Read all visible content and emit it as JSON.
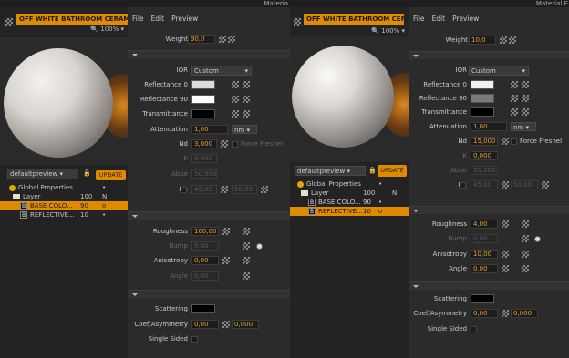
{
  "left": {
    "title": "Materia",
    "material_name": "OFF WHITE BATHROOM CERAMIC",
    "zoom": "100%",
    "preview_mode": "defaultpreview",
    "update_label": "UPDATE",
    "tree": [
      {
        "label": "Global Properties",
        "c1": "",
        "c2": "•"
      },
      {
        "label": "Layer",
        "c1": "100",
        "c2": "N"
      },
      {
        "label": "BASE COLO...",
        "c1": "90",
        "c2": "o"
      },
      {
        "label": "REFLECTIVE...",
        "c1": "10",
        "c2": "•"
      }
    ],
    "menu": [
      "File",
      "Edit",
      "Preview"
    ],
    "weight_label": "Weight",
    "weight": "90,0",
    "ior_label": "IOR",
    "ior_value": "Custom",
    "refl0_label": "Reflectance 0",
    "refl90_label": "Reflectance 90",
    "trans_label": "Transmittance",
    "atten_label": "Attenuation",
    "atten": "1,00",
    "atten_unit": "nm",
    "nd_label": "Nd",
    "nd": "3,000",
    "force_fresnel": "Force Fresnel",
    "k_label": "K",
    "k": "0,000",
    "abbe_label": "Abbe",
    "abbe": "50,000",
    "r2_label": "R2",
    "r2a": "45,00",
    "r2b": "50,00",
    "rough_label": "Roughness",
    "rough": "100,00",
    "bump_label": "Bump",
    "bump": "0,00",
    "aniso_label": "Anisotropy",
    "aniso": "0,00",
    "angle_label": "Angle",
    "angle": "0,00",
    "scatter_label": "Scattering",
    "coef_label": "Coef/Asymmetry",
    "coef_a": "0,00",
    "coef_b": "0,000",
    "single_label": "Single Sided"
  },
  "right": {
    "title": "Material E",
    "material_name": "OFF WHITE BATHROOM CERAMIC",
    "zoom": "100%",
    "preview_mode": "defaultpreview",
    "update_label": "UPDATE",
    "tree": [
      {
        "label": "Global Properties",
        "c1": "",
        "c2": "•"
      },
      {
        "label": "Layer",
        "c1": "100",
        "c2": "N"
      },
      {
        "label": "BASE COLO...",
        "c1": "90",
        "c2": "•"
      },
      {
        "label": "REFLECTIVE...",
        "c1": "10",
        "c2": "o"
      }
    ],
    "menu": [
      "File",
      "Edit",
      "Preview"
    ],
    "weight": "10,0",
    "ior_value": "Custom",
    "atten": "1,00",
    "atten_unit": "nm",
    "nd": "15,000",
    "k": "0,000",
    "abbe": "50,000",
    "r2a": "45,00",
    "r2b": "50,00",
    "rough": "4,00",
    "bump": "0,00",
    "aniso": "10,00",
    "angle": "0,00",
    "coef_a": "0,00",
    "coef_b": "0,000"
  },
  "colors": {
    "accent": "#e08a00",
    "value": "#e8a030",
    "bg": "#2b2b2b"
  }
}
